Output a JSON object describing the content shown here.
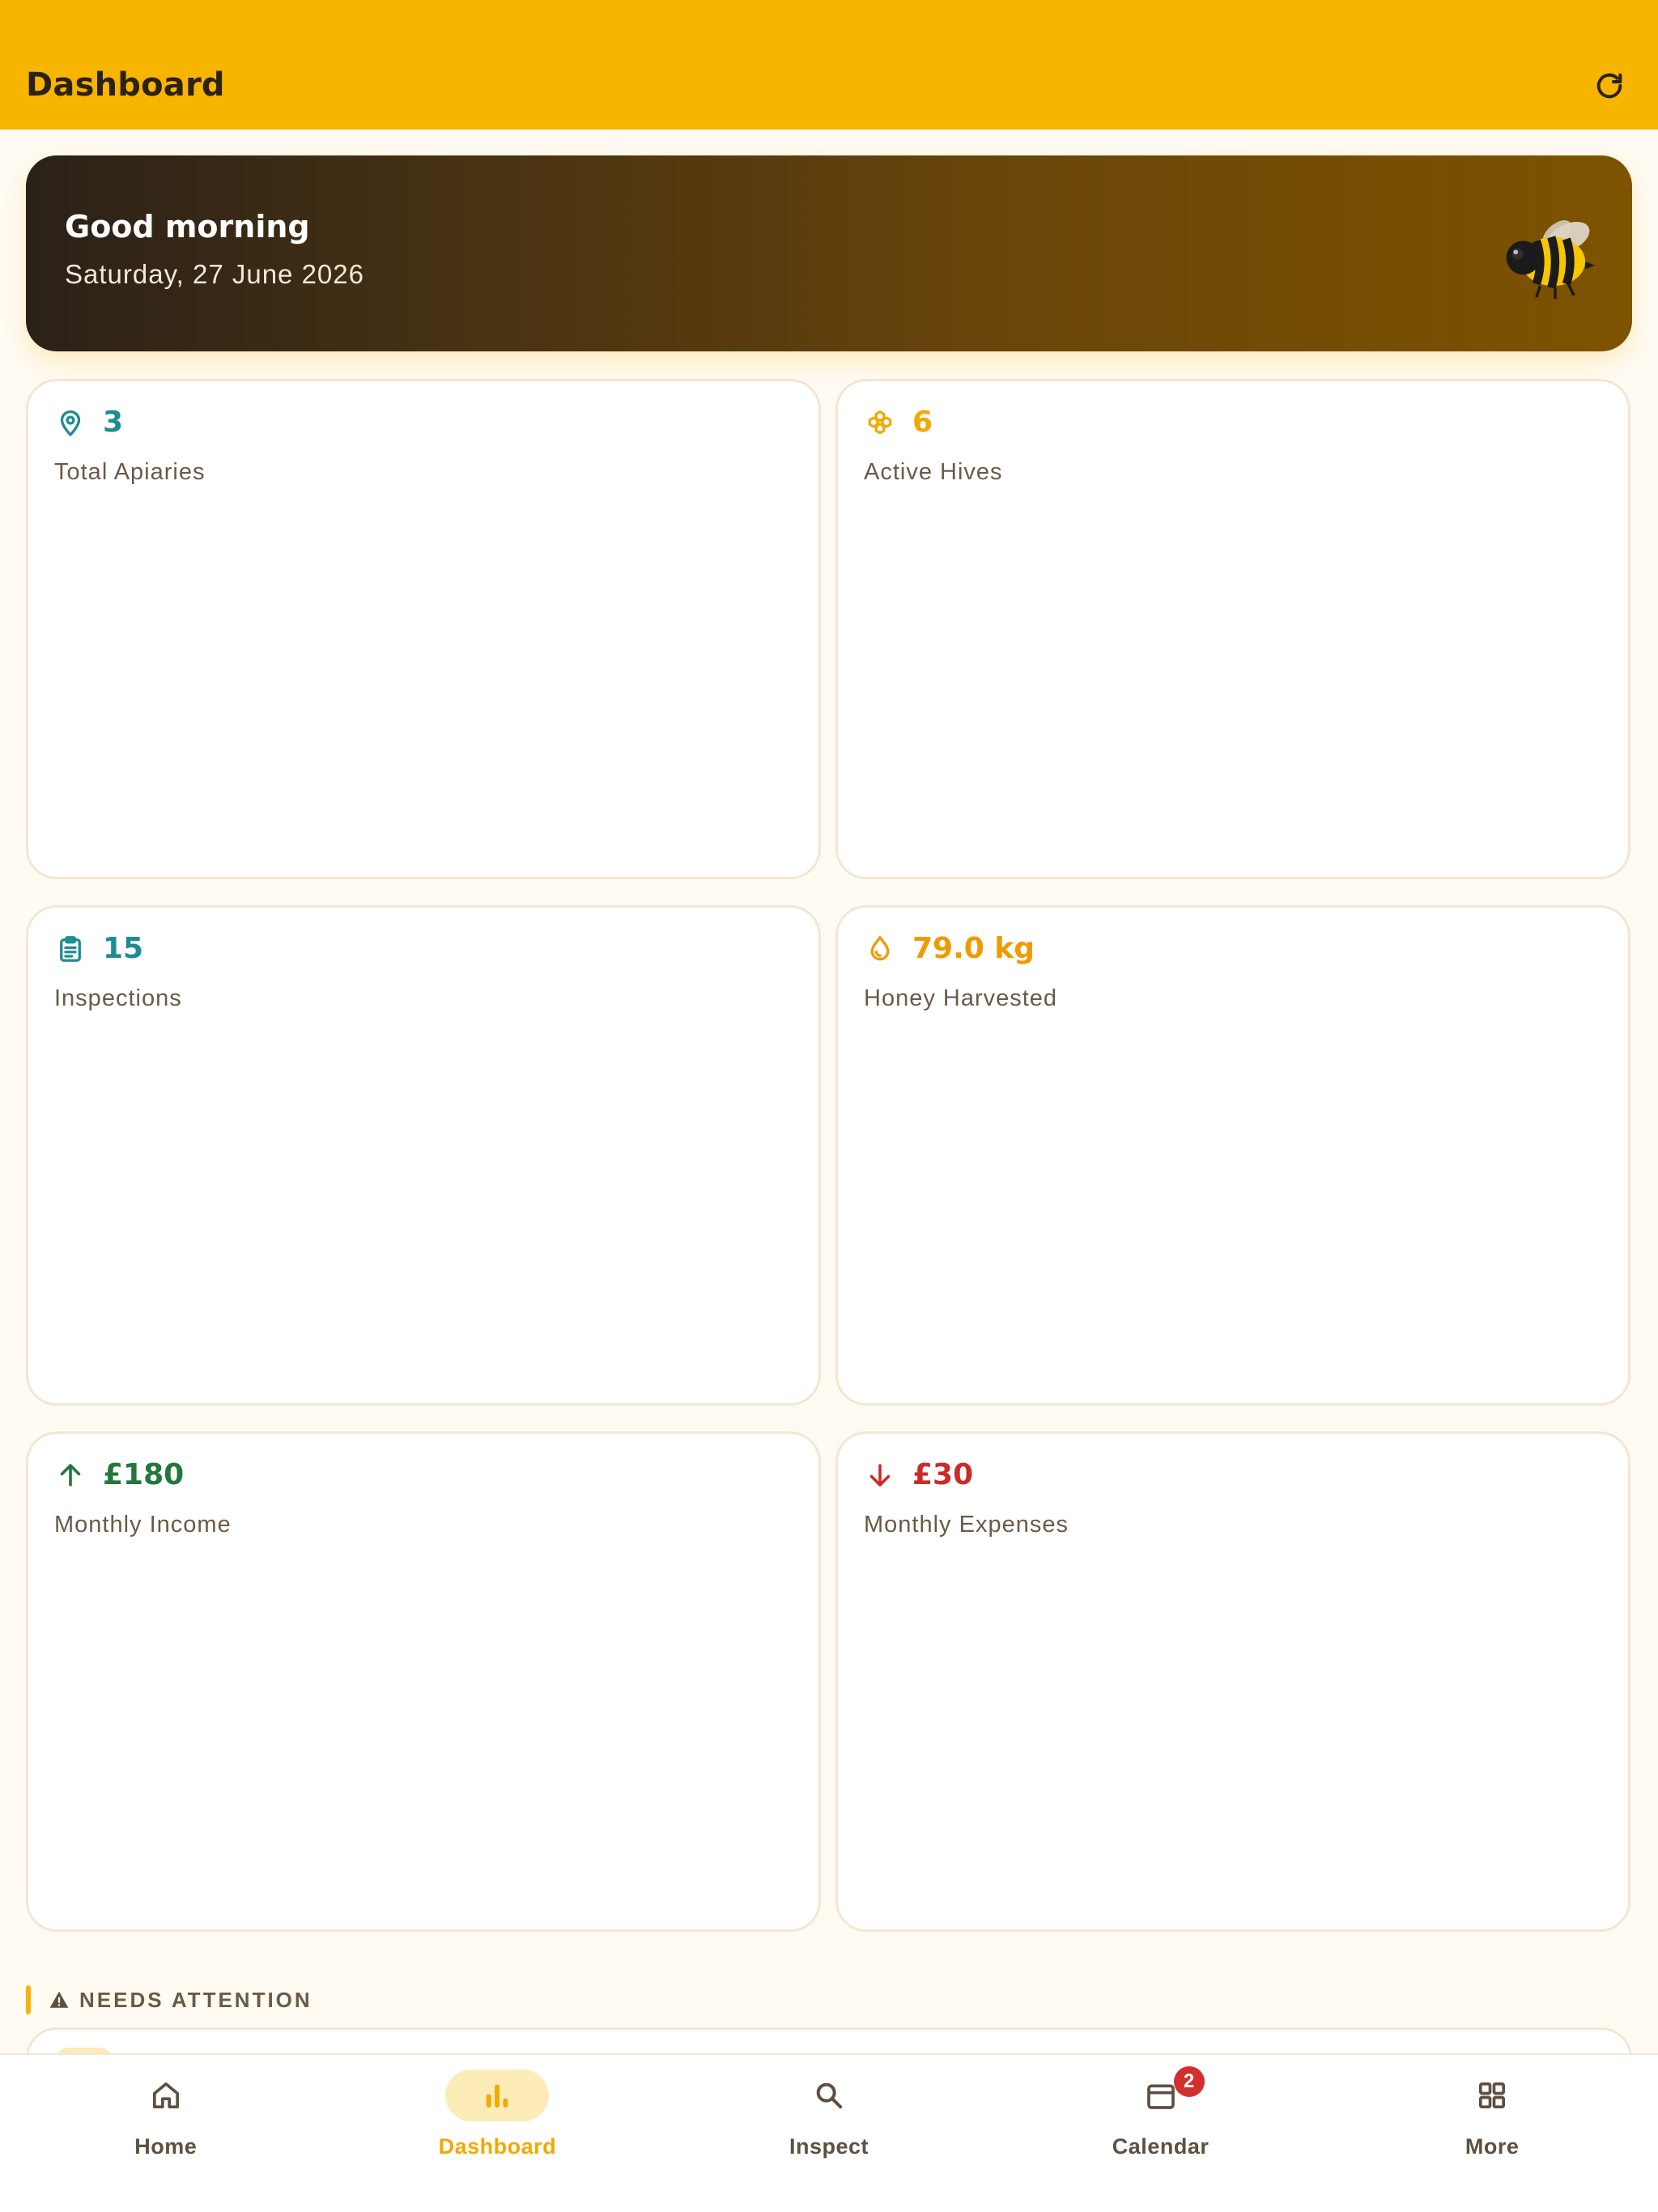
{
  "app_bar": {
    "title": "Dashboard",
    "refresh_icon": "refresh-icon",
    "background": "#F8B500"
  },
  "greeting": {
    "title": "Good morning",
    "date": "Saturday, 27 June 2026",
    "icon": "bee-icon"
  },
  "stats": [
    {
      "value": "3",
      "label": "Total Apiaries",
      "icon": "location-pin-icon",
      "color": "#1E8C93"
    },
    {
      "value": "6",
      "label": "Active Hives",
      "icon": "hive-icon",
      "color": "#F2A900"
    },
    {
      "value": "15",
      "label": "Inspections",
      "icon": "clipboard-icon",
      "color": "#1E8C93"
    },
    {
      "value": "79.0 kg",
      "label": "Honey Harvested",
      "icon": "honey-drop-icon",
      "color": "#F09A00"
    },
    {
      "value": "£180",
      "label": "Monthly Income",
      "icon": "arrow-up-icon",
      "color": "#23773A"
    },
    {
      "value": "£30",
      "label": "Monthly Expenses",
      "icon": "arrow-down-icon",
      "color": "#CB2B2B"
    }
  ],
  "attention": {
    "title": "NEEDS ATTENTION",
    "icon": "warning-icon"
  },
  "bottom_nav": {
    "items": [
      {
        "label": "Home",
        "icon": "home-icon",
        "active": false
      },
      {
        "label": "Dashboard",
        "icon": "bar-chart-icon",
        "active": true
      },
      {
        "label": "Inspect",
        "icon": "search-icon",
        "active": false
      },
      {
        "label": "Calendar",
        "icon": "calendar-icon",
        "active": false,
        "badge": "2"
      },
      {
        "label": "More",
        "icon": "grid-icon",
        "active": false
      }
    ]
  }
}
